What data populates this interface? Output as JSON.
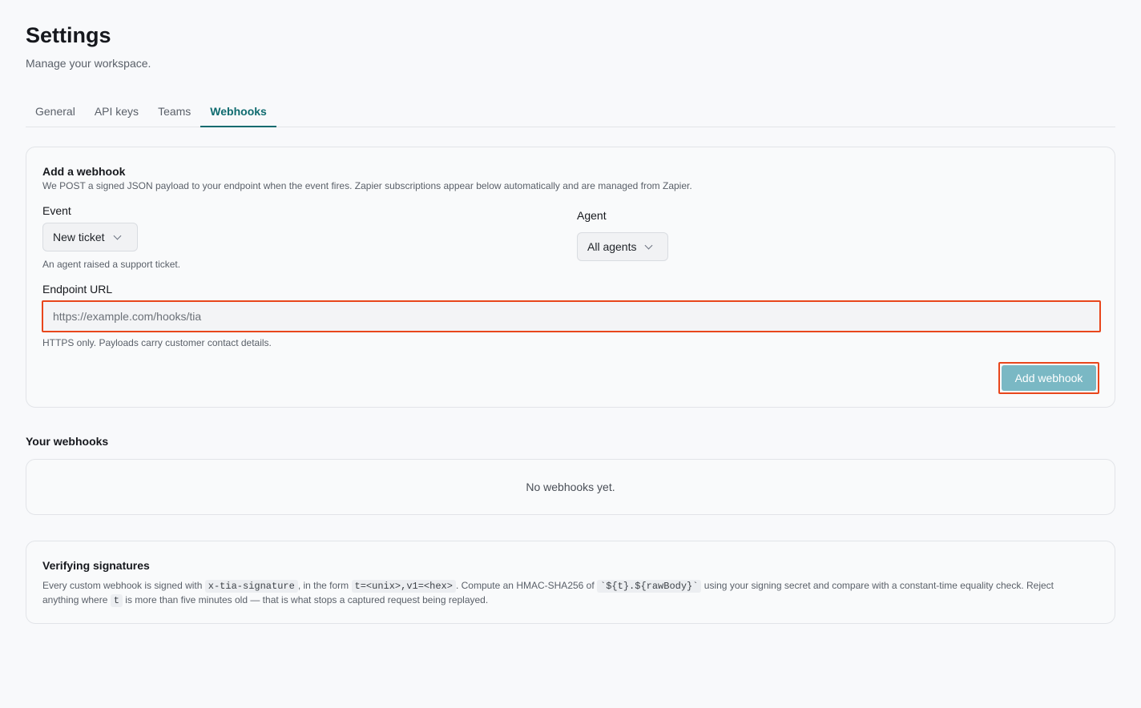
{
  "header": {
    "title": "Settings",
    "subtitle": "Manage your workspace."
  },
  "tabs": [
    {
      "label": "General",
      "active": false
    },
    {
      "label": "API keys",
      "active": false
    },
    {
      "label": "Teams",
      "active": false
    },
    {
      "label": "Webhooks",
      "active": true
    }
  ],
  "add_webhook": {
    "heading": "Add a webhook",
    "description": "We POST a signed JSON payload to your endpoint when the event fires. Zapier subscriptions appear below automatically and are managed from Zapier.",
    "event": {
      "label": "Event",
      "selected": "New ticket",
      "hint": "An agent raised a support ticket."
    },
    "agent": {
      "label": "Agent",
      "selected": "All agents"
    },
    "endpoint": {
      "label": "Endpoint URL",
      "value": "",
      "placeholder": "https://example.com/hooks/tia",
      "hint": "HTTPS only. Payloads carry customer contact details."
    },
    "submit_label": "Add webhook"
  },
  "your_webhooks": {
    "title": "Your webhooks",
    "empty_text": "No webhooks yet."
  },
  "verify": {
    "heading": "Verifying signatures",
    "t1": "Every custom webhook is signed with",
    "c1": "x-tia-signature",
    "t2": ", in the form",
    "c2": "t=<unix>,v1=<hex>",
    "t3": ". Compute an HMAC-SHA256 of",
    "c3": "`${t}.${rawBody}`",
    "t4": "using your signing secret and compare with a constant-time equality check. Reject anything where",
    "c4": "t",
    "t5": "is more than five minutes old — that is what stops a captured request being replayed."
  },
  "colors": {
    "accent": "#0f6b6f",
    "highlight": "#e8461c",
    "button_bg": "#7ab8c4"
  }
}
